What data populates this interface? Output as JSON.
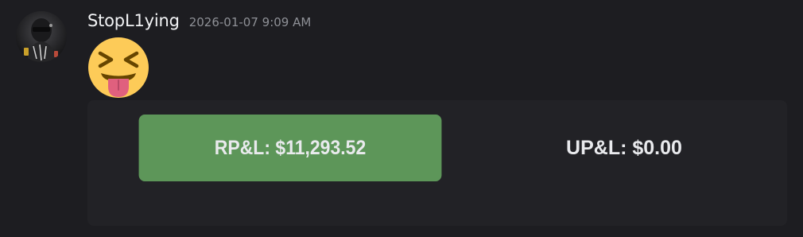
{
  "message": {
    "author": "StopL1ying",
    "timestamp": "2026-01-07 9:09 AM",
    "emoji": "squinting-face-with-tongue",
    "avatar_icon": "user-avatar"
  },
  "embed": {
    "realized_pnl_label": "RP&L: $11,293.52",
    "unrealized_pnl_label": "UP&L: $0.00",
    "colors": {
      "realized_bg": "#5d9659",
      "embed_bg": "#222226",
      "page_bg": "#1d1d21"
    }
  }
}
